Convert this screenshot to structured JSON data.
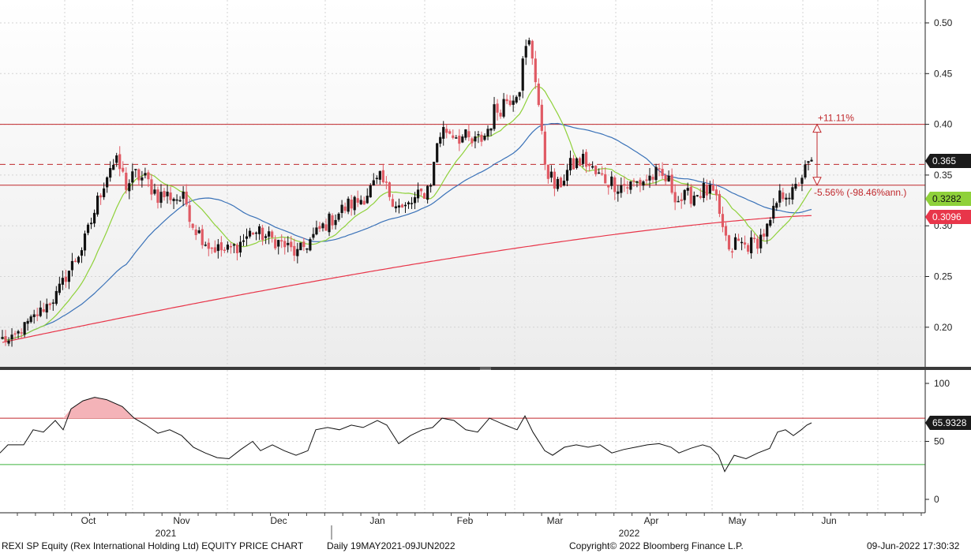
{
  "chart_data": [
    {
      "type": "candlestick",
      "title": "REXI SP Equity (Rex International Holding Ltd) EQUITY PRICE CHART",
      "period": "Daily 19MAY2021-09JUN2022",
      "ylim": [
        0.165,
        0.52
      ],
      "yticks": [
        "0.50",
        "0.45",
        "0.40",
        "0.35",
        "0.30",
        "0.25",
        "0.20"
      ],
      "ytick_values": [
        0.5,
        0.45,
        0.4,
        0.35,
        0.3,
        0.25,
        0.2
      ],
      "months": [
        "Oct",
        "Nov",
        "Dec",
        "Jan",
        "Feb",
        "Mar",
        "Apr",
        "May",
        "Jun"
      ],
      "years": [
        "2021",
        "2022"
      ],
      "grid": true,
      "ohlc_keypoints": [
        {
          "date": "Sep",
          "close": 0.19
        },
        {
          "date": "early Oct",
          "close": 0.36
        },
        {
          "date": "Nov",
          "close": 0.325
        },
        {
          "date": "late Nov",
          "close": 0.27
        },
        {
          "date": "Dec",
          "close": 0.28
        },
        {
          "date": "Jan",
          "close": 0.35
        },
        {
          "date": "mid Jan",
          "close": 0.315
        },
        {
          "date": "Feb",
          "close": 0.39
        },
        {
          "date": "late Feb",
          "close": 0.485,
          "note": "peak"
        },
        {
          "date": "early Mar",
          "close": 0.33
        },
        {
          "date": "Apr",
          "close": 0.34
        },
        {
          "date": "early May",
          "close": 0.26
        },
        {
          "date": "Jun",
          "close": 0.365
        }
      ],
      "last_price": "0.365",
      "moving_averages": [
        {
          "color": "#8fd13a",
          "last": null
        },
        {
          "color": "#3a72b8",
          "last": "0.3282"
        },
        {
          "color": "#e8364a",
          "last": "0.3096"
        }
      ],
      "levels": [
        {
          "value": 0.4,
          "style": "solid",
          "color": "#c0282c"
        },
        {
          "value": 0.3605,
          "style": "dashed",
          "color": "#c0282c"
        },
        {
          "value": 0.34,
          "style": "solid",
          "color": "#c0282c"
        }
      ],
      "annotations": [
        "+11.11%",
        "-5.56% (-98.46%ann.)"
      ]
    },
    {
      "type": "line",
      "ylim": [
        -5,
        105
      ],
      "yticks": [
        "100",
        "50",
        "0"
      ],
      "ytick_values": [
        100,
        50,
        0
      ],
      "bands": [
        {
          "value": 70,
          "color": "#c0282c"
        },
        {
          "value": 30,
          "color": "#3cb33c"
        }
      ],
      "last_value": "65.9328",
      "keypoints": [
        {
          "date": "Sep",
          "value": 41
        },
        {
          "date": "early Oct",
          "value": 90
        },
        {
          "date": "Nov",
          "value": 58
        },
        {
          "date": "late Nov",
          "value": 37
        },
        {
          "date": "Dec",
          "value": 38
        },
        {
          "date": "Jan",
          "value": 62
        },
        {
          "date": "Feb",
          "value": 72
        },
        {
          "date": "late Feb",
          "value": 75
        },
        {
          "date": "early Mar",
          "value": 42
        },
        {
          "date": "Apr",
          "value": 45
        },
        {
          "date": "early May",
          "value": 22
        },
        {
          "date": "Jun",
          "value": 66
        }
      ]
    }
  ],
  "footer": {
    "title": "REXI SP Equity (Rex International Holding Ltd) EQUITY PRICE CHART",
    "period": "Daily 19MAY2021-09JUN2022",
    "copyright": "Copyright© 2022 Bloomberg Finance L.P.",
    "timestamp": "09-Jun-2022 17:30:32"
  },
  "colors": {
    "up": "#111111",
    "down": "#e05a64",
    "ma_fast": "#8fd13a",
    "ma_mid": "#3a72b8",
    "ma_slow": "#e8364a",
    "level": "#c0282c",
    "rsi_low": "#3cb33c",
    "rsi_fill": "#f4b3b8"
  }
}
